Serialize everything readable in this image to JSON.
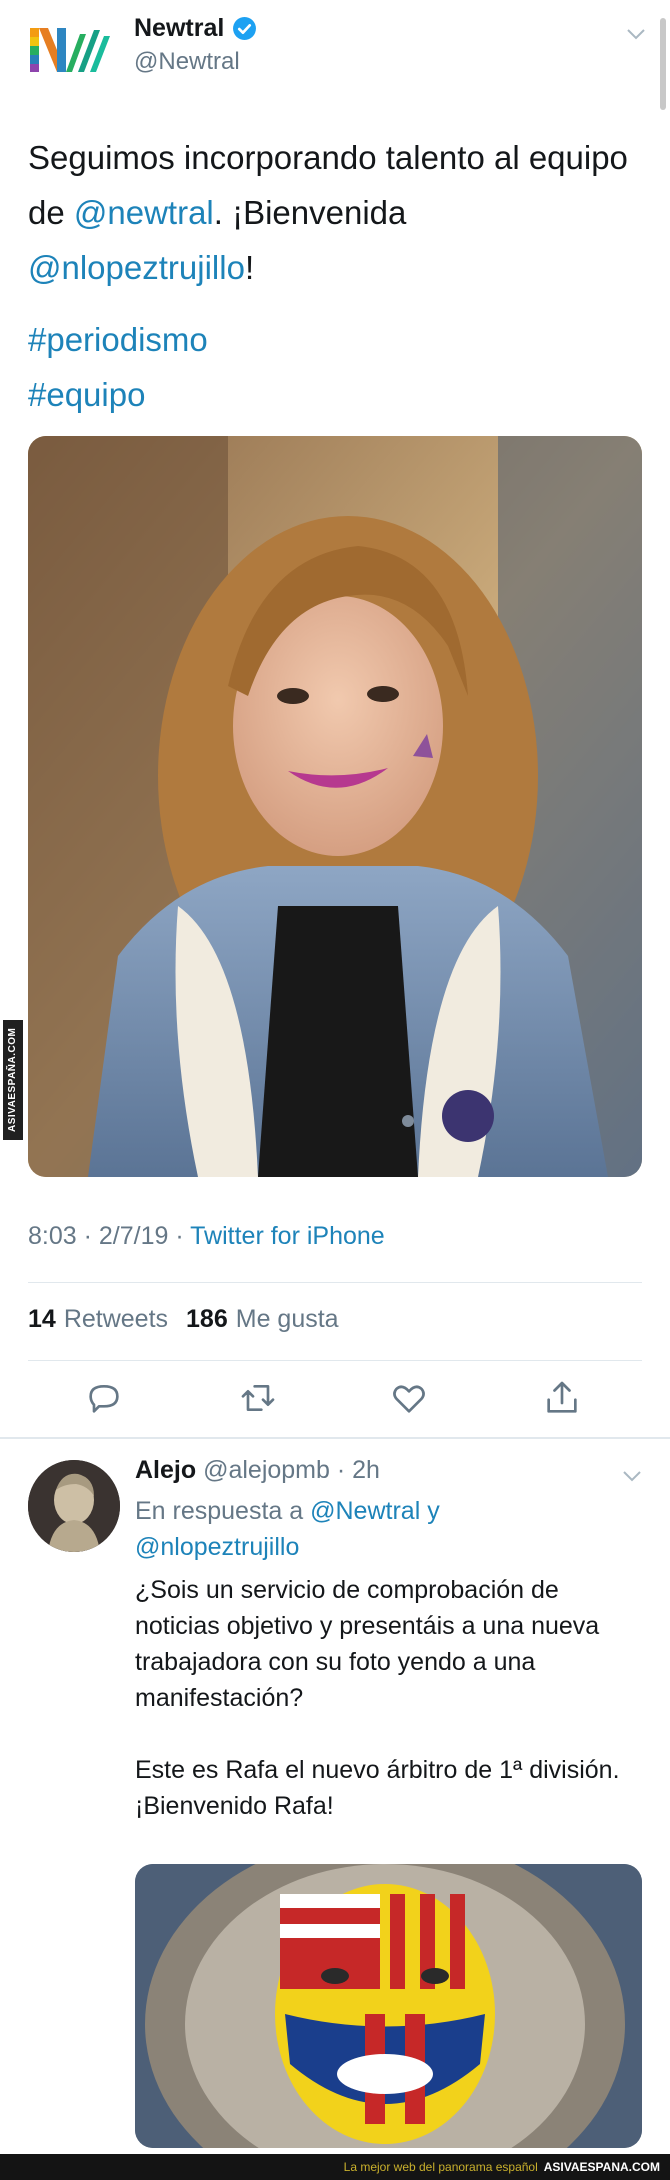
{
  "tweet": {
    "author_name": "Newtral",
    "author_handle": "@Newtral",
    "text_part1": "Seguimos incorporando talento al equipo de ",
    "mention1": "@newtral",
    "text_part2": ". ¡Bienvenida ",
    "mention2": "@nlopeztrujillo",
    "text_part3": "!",
    "hashtags": [
      "#periodismo",
      "#equipo"
    ],
    "time": "8:03 · 2/7/19 · ",
    "source": "Twitter for iPhone",
    "retweets_count": "14",
    "retweets_label": "Retweets",
    "likes_count": "186",
    "likes_label": "Me gusta",
    "photo_badge": "ASIVAESPANA",
    "icons": {
      "logo": "newtral-logo",
      "verified": "verified-badge-icon",
      "more": "chevron-down-icon",
      "reply": "reply-icon",
      "retweet": "retweet-icon",
      "like": "heart-icon",
      "share": "share-icon"
    }
  },
  "watermark_side": "ASIVAESPAÑA.COM",
  "reply": {
    "name": "Alejo",
    "handle": "@alejopmb",
    "time": " · 2h",
    "in_reply_prefix": "En respuesta a ",
    "reply_mention1": "@Newtral",
    "reply_joiner": " y",
    "reply_mention2": "@nlopeztrujillo",
    "paragraph1": "¿Sois un servicio de comprobación de noticias objetivo y presentáis a una nueva trabajadora con su foto yendo a una manifestación?",
    "paragraph2_line1": "Este es Rafa el nuevo árbitro de 1ª división.",
    "paragraph2_line2": "¡Bienvenido Rafa!"
  },
  "footer": {
    "tagline": "La mejor web del panorama español",
    "brand": "ASIVAESPANA.COM"
  },
  "colors": {
    "link": "#1d83b9",
    "text": "#14171a",
    "muted": "#657786",
    "divider": "#e1e8ed"
  }
}
